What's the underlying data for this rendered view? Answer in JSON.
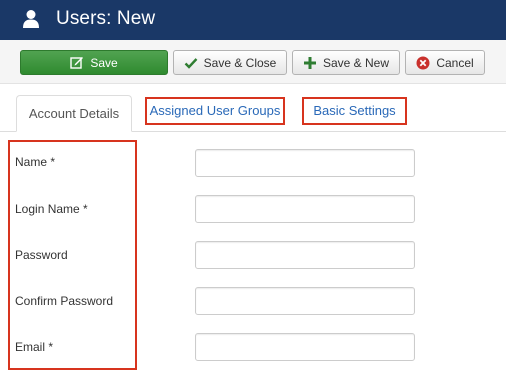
{
  "header": {
    "title": "Users: New",
    "icon": "user-icon"
  },
  "toolbar": {
    "save_label": "Save",
    "save_close_label": "Save & Close",
    "save_new_label": "Save & New",
    "cancel_label": "Cancel"
  },
  "tabs": [
    {
      "label": "Account Details",
      "active": true
    },
    {
      "label": "Assigned User Groups",
      "active": false
    },
    {
      "label": "Basic Settings",
      "active": false
    }
  ],
  "form": {
    "fields": [
      {
        "label": "Name *",
        "value": ""
      },
      {
        "label": "Login Name *",
        "value": ""
      },
      {
        "label": "Password",
        "value": ""
      },
      {
        "label": "Confirm Password",
        "value": ""
      },
      {
        "label": "Email *",
        "value": ""
      }
    ]
  },
  "colors": {
    "header_bg": "#1a3867",
    "save_green": "#3c9a3c",
    "link_blue": "#2a69b8",
    "highlight_red": "#d7341e"
  }
}
